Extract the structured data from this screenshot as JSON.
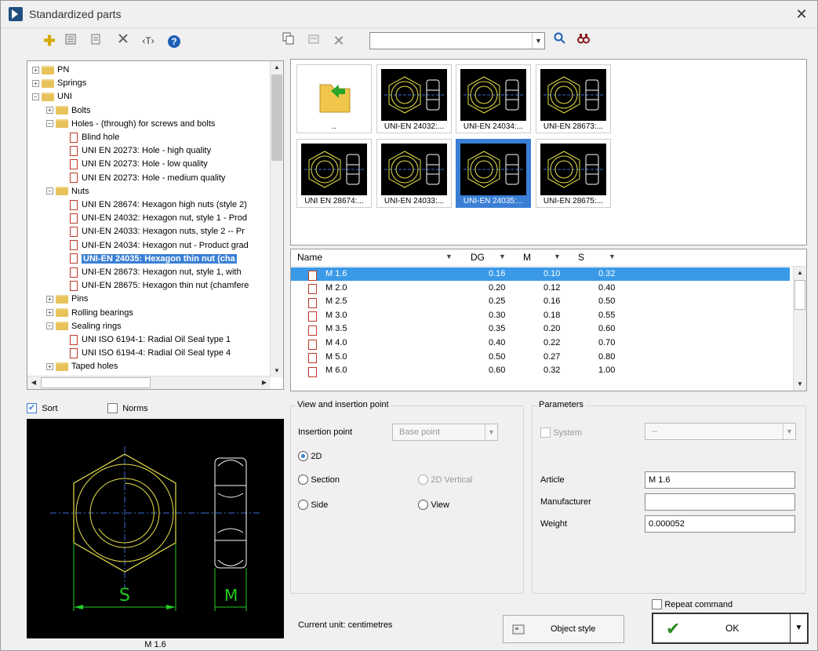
{
  "window": {
    "title": "Standardized parts",
    "close": "✕"
  },
  "toolbar": {
    "icons": [
      "add-icon",
      "list-icon",
      "document-icon",
      "tools-icon",
      "text-tag-icon",
      "help-icon",
      "copy-icon",
      "properties-icon",
      "delete-icon",
      "search-icon",
      "binoculars-icon"
    ],
    "tag_glyph": "‹T›",
    "help_glyph": "?",
    "search_value": ""
  },
  "tree": {
    "rows": [
      {
        "label": "PN",
        "type": "folder",
        "indent": 0,
        "exp": "+"
      },
      {
        "label": "Springs",
        "type": "folder",
        "indent": 0,
        "exp": "+"
      },
      {
        "label": "UNI",
        "type": "folder",
        "indent": 0,
        "exp": "-"
      },
      {
        "label": "Bolts",
        "type": "folder",
        "indent": 1,
        "exp": "+"
      },
      {
        "label": "Holes - (through) for screws and bolts",
        "type": "folder",
        "indent": 1,
        "exp": "-"
      },
      {
        "label": "Blind hole",
        "type": "doc",
        "indent": 2
      },
      {
        "label": "UNI EN 20273: Hole - high quality",
        "type": "doc",
        "indent": 2
      },
      {
        "label": "UNI EN 20273: Hole - low quality",
        "type": "doc",
        "indent": 2
      },
      {
        "label": "UNI EN 20273: Hole - medium quality",
        "type": "doc",
        "indent": 2
      },
      {
        "label": "Nuts",
        "type": "folder",
        "indent": 1,
        "exp": "-"
      },
      {
        "label": "UNI EN 28674: Hexagon high nuts (style 2)",
        "type": "doc",
        "indent": 2
      },
      {
        "label": "UNI-EN 24032: Hexagon nut, style 1 - Prod",
        "type": "doc",
        "indent": 2
      },
      {
        "label": "UNI-EN 24033: Hexagon nuts, style 2 -- Pr",
        "type": "doc",
        "indent": 2
      },
      {
        "label": "UNI-EN 24034: Hexagon nut - Product grad",
        "type": "doc",
        "indent": 2
      },
      {
        "label": "UNI-EN 24035: Hexagon thin nut (cha",
        "type": "doc",
        "indent": 2,
        "selected": true
      },
      {
        "label": "UNI-EN 28673: Hexagon nut, style 1, with",
        "type": "doc",
        "indent": 2
      },
      {
        "label": "UNI-EN 28675: Hexagon thin nut (chamfere",
        "type": "doc",
        "indent": 2
      },
      {
        "label": "Pins",
        "type": "folder",
        "indent": 1,
        "exp": "+"
      },
      {
        "label": "Rolling bearings",
        "type": "folder",
        "indent": 1,
        "exp": "+"
      },
      {
        "label": "Sealing rings",
        "type": "folder",
        "indent": 1,
        "exp": "-"
      },
      {
        "label": "UNI ISO 6194-1: Radial Oil Seal type 1",
        "type": "doc",
        "indent": 2
      },
      {
        "label": "UNI ISO 6194-4: Radial Oil Seal type 4",
        "type": "doc",
        "indent": 2
      },
      {
        "label": "Taped holes",
        "type": "folder",
        "indent": 1,
        "exp": "+"
      }
    ]
  },
  "thumbnails": [
    {
      "caption": "..",
      "kind": "up",
      "selected": false
    },
    {
      "caption": "UNI-EN 24032:...",
      "kind": "nut",
      "selected": false
    },
    {
      "caption": "UNI-EN 24034:...",
      "kind": "nut",
      "selected": false
    },
    {
      "caption": "UNI-EN 28673:...",
      "kind": "nut",
      "selected": false
    },
    {
      "caption": "UNI EN 28674:...",
      "kind": "nut",
      "selected": false
    },
    {
      "caption": "UNI-EN 24033:...",
      "kind": "nut",
      "selected": false
    },
    {
      "caption": "UNI-EN 24035:...",
      "kind": "nut",
      "selected": true
    },
    {
      "caption": "UNI-EN 28675:...",
      "kind": "nut",
      "selected": false
    }
  ],
  "grid": {
    "columns": [
      "Name",
      "DG",
      "M",
      "S"
    ],
    "rows": [
      {
        "name": "M 1.6",
        "dg": "0.16",
        "m": "0.10",
        "s": "0.32",
        "selected": true
      },
      {
        "name": "M 2.0",
        "dg": "0.20",
        "m": "0.12",
        "s": "0.40"
      },
      {
        "name": "M 2.5",
        "dg": "0.25",
        "m": "0.16",
        "s": "0.50"
      },
      {
        "name": "M 3.0",
        "dg": "0.30",
        "m": "0.18",
        "s": "0.55"
      },
      {
        "name": "M 3.5",
        "dg": "0.35",
        "m": "0.20",
        "s": "0.60"
      },
      {
        "name": "M 4.0",
        "dg": "0.40",
        "m": "0.22",
        "s": "0.70"
      },
      {
        "name": "M 5.0",
        "dg": "0.50",
        "m": "0.27",
        "s": "0.80"
      },
      {
        "name": "M 6.0",
        "dg": "0.60",
        "m": "0.32",
        "s": "1.00"
      }
    ]
  },
  "filters": {
    "sort_label": "Sort",
    "sort_checked": true,
    "norms_label": "Norms",
    "norms_checked": false
  },
  "preview": {
    "caption": "M 1.6",
    "s_label": "S",
    "m_label": "M"
  },
  "view_group": {
    "title": "View and insertion point",
    "insertion_label": "Insertion point",
    "insertion_value": "Base point",
    "options": {
      "o2d": "2D",
      "section": "Section",
      "side": "Side",
      "vertical": "2D Vertical",
      "view": "View"
    },
    "selected": "2D"
  },
  "params_group": {
    "title": "Parameters",
    "system_label": "System",
    "system_value": "--",
    "article_label": "Article",
    "article_value": "M 1.6",
    "manufacturer_label": "Manufacturer",
    "manufacturer_value": "",
    "weight_label": "Weight",
    "weight_value": "0.000052"
  },
  "footer": {
    "unit_text": "Current unit: centimetres",
    "object_style": "Object style",
    "repeat_label": "Repeat command",
    "ok_label": "OK"
  },
  "colors": {
    "accent": "#3a7fd5",
    "folder": "#e8c25a",
    "drawing_line": "#e8e04a",
    "dimension": "#22cc22",
    "centerline": "#3a6ed6"
  }
}
